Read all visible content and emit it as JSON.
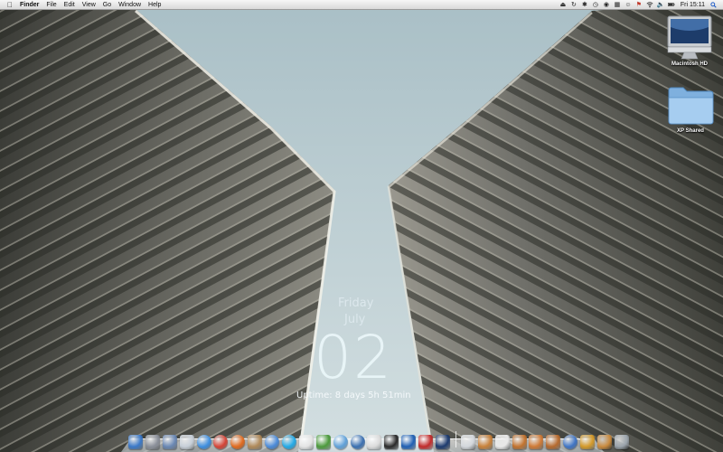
{
  "menubar": {
    "app_name": "Finder",
    "menus": [
      "File",
      "Edit",
      "View",
      "Go",
      "Window",
      "Help"
    ],
    "clock": "Fri 15:11",
    "status_icons": [
      "eject-icon",
      "sync-icon",
      "bluetooth-icon",
      "timemachine-icon",
      "headphones-icon",
      "wifi-icon",
      "volume-icon",
      "battery-icon",
      "flag-icon"
    ]
  },
  "desktop_icons": [
    {
      "name": "macintosh-hd",
      "label": "Macintosh HD",
      "icon": "imac-icon"
    },
    {
      "name": "xp-shared",
      "label": "XP Shared",
      "icon": "folder-icon"
    }
  ],
  "widget": {
    "day": "Friday",
    "month": "July",
    "date": "02",
    "uptime": "Uptime: 8 days 5h 51min"
  },
  "dock": {
    "apps": [
      {
        "name": "finder-icon",
        "color": "#3b79c9"
      },
      {
        "name": "system-preferences-icon",
        "color": "#8a8f99"
      },
      {
        "name": "preview-icon",
        "color": "#6a88b4"
      },
      {
        "name": "mail-icon",
        "color": "#c7cfd8"
      },
      {
        "name": "safari-icon",
        "color": "#3e8fe0"
      },
      {
        "name": "chrome-icon",
        "color": "#d44336"
      },
      {
        "name": "firefox-icon",
        "color": "#e06a1e"
      },
      {
        "name": "address-book-icon",
        "color": "#b08a5a"
      },
      {
        "name": "ichat-icon",
        "color": "#4a8ad8"
      },
      {
        "name": "skype-icon",
        "color": "#22a9e6"
      },
      {
        "name": "ical-icon",
        "color": "#e4e4e4"
      },
      {
        "name": "utorrent-icon",
        "color": "#4c9a3c"
      },
      {
        "name": "itunes-icon",
        "color": "#5fa0d8"
      },
      {
        "name": "quicktime-icon",
        "color": "#3a6fb0"
      },
      {
        "name": "textedit-icon",
        "color": "#dcdcdc"
      },
      {
        "name": "terminal-icon",
        "color": "#2a2a2a"
      },
      {
        "name": "teamviewer-icon",
        "color": "#1f5fb3"
      },
      {
        "name": "acrobat-icon",
        "color": "#c12b2b"
      },
      {
        "name": "photoshop-icon",
        "color": "#1c3a6e"
      }
    ],
    "stacks": [
      {
        "name": "applications-stack-icon",
        "color": "#d3d7dc"
      },
      {
        "name": "documents-stack-icon",
        "color": "#c8813a"
      },
      {
        "name": "downloads-stack-icon",
        "color": "#e8e8e8"
      },
      {
        "name": "music-stack-icon",
        "color": "#c2732f"
      },
      {
        "name": "pictures-stack-icon",
        "color": "#cf7a36"
      },
      {
        "name": "movies-stack-icon",
        "color": "#b66a2e"
      },
      {
        "name": "network-icon",
        "color": "#3f74c4"
      },
      {
        "name": "sites-stack-icon",
        "color": "#d49a2a"
      },
      {
        "name": "folder-stack-icon",
        "color": "#c98a3e"
      },
      {
        "name": "trash-icon",
        "color": "#9aa3ab"
      }
    ]
  },
  "colors": {
    "sky": "#c6d6da",
    "building": "#8a8a80",
    "menubar": "#e6e6e6",
    "widget_text": "#eef8fb"
  }
}
